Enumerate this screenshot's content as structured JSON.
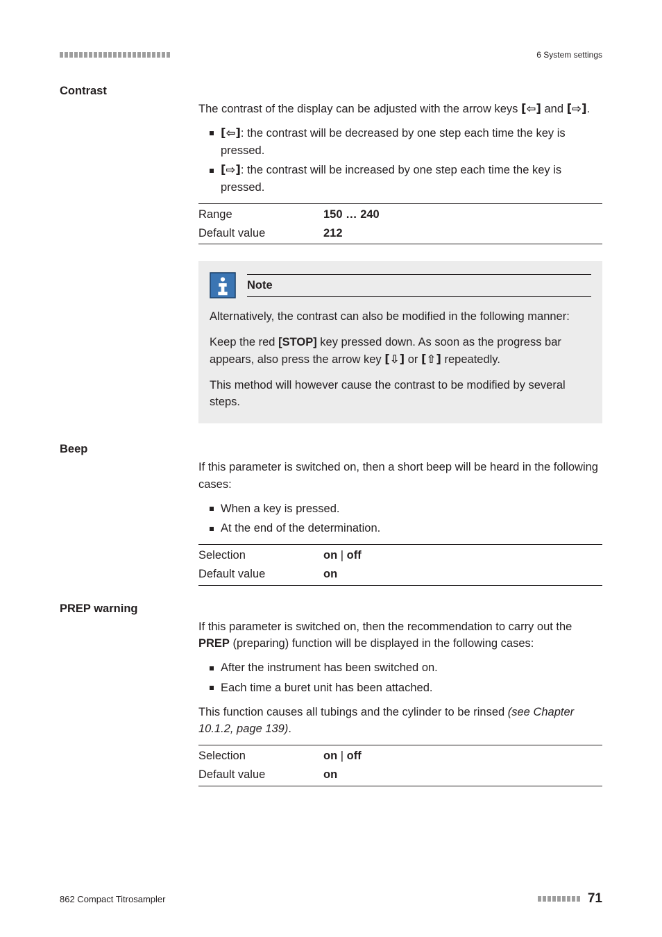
{
  "header": {
    "chapter": "6 System settings"
  },
  "contrast": {
    "label": "Contrast",
    "intro_pre": "The contrast of the display can be adjusted with the arrow keys ",
    "intro_key1": "[⇦]",
    "intro_mid": " and ",
    "intro_key2": "[⇨]",
    "intro_end": ".",
    "b1_key": "[⇦]",
    "b1_text": ": the contrast will be decreased by one step each time the key is pressed.",
    "b2_key": "[⇨]",
    "b2_text": ": the contrast will be increased by one step each time the key is pressed.",
    "range_label": "Range",
    "range_value": "150 … 240",
    "default_label": "Default value",
    "default_value": "212",
    "note_title": "Note",
    "note_p1": "Alternatively, the contrast can also be modified in the following manner:",
    "note_p2_pre": "Keep the red ",
    "note_p2_stop": "[STOP]",
    "note_p2_mid": " key pressed down. As soon as the progress bar appears, also press the arrow key ",
    "note_p2_k1": "[⇩]",
    "note_p2_or": " or ",
    "note_p2_k2": "[⇧]",
    "note_p2_end": " repeatedly.",
    "note_p3": "This method will however cause the contrast to be modified by several steps."
  },
  "beep": {
    "label": "Beep",
    "intro": "If this parameter is switched on, then a short beep will be heard in the following cases:",
    "b1": "When a key is pressed.",
    "b2": "At the end of the determination.",
    "sel_label": "Selection",
    "sel_on": "on",
    "sel_sep": " | ",
    "sel_off": "off",
    "default_label": "Default value",
    "default_value": "on"
  },
  "prep": {
    "label": "PREP warning",
    "intro_pre": "If this parameter is switched on, then the recommendation to carry out the ",
    "intro_prep": "PREP",
    "intro_end": " (preparing) function will be displayed in the following cases:",
    "b1": "After the instrument has been switched on.",
    "b2": "Each time a buret unit has been attached.",
    "rinse_pre": "This function causes all tubings and the cylinder to be rinsed ",
    "rinse_ref": "(see Chapter 10.1.2, page 139)",
    "rinse_end": ".",
    "sel_label": "Selection",
    "sel_on": "on",
    "sel_sep": " | ",
    "sel_off": "off",
    "default_label": "Default value",
    "default_value": "on"
  },
  "footer": {
    "product": "862 Compact Titrosampler",
    "page": "71"
  }
}
